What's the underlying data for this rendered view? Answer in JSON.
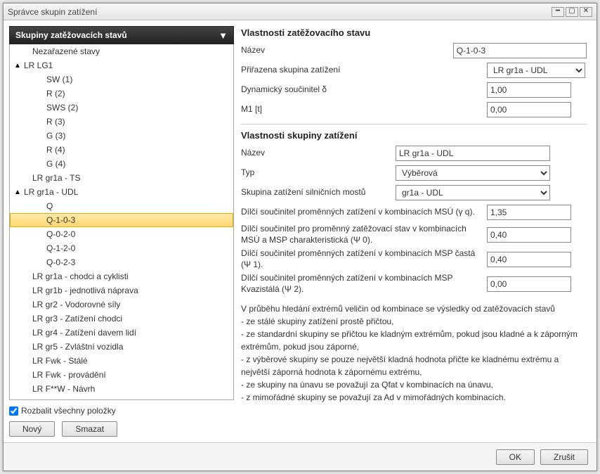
{
  "window": {
    "title": "Správce skupin zatížení"
  },
  "tree": {
    "header": "Skupiny zatěžovacích stavů",
    "items": [
      {
        "label": "Nezařazené stavy",
        "pad": "pad1",
        "arrow": ""
      },
      {
        "label": "LR LG1",
        "pad": "pad0",
        "arrow": "▲"
      },
      {
        "label": "SW (1)",
        "pad": "pad2",
        "arrow": ""
      },
      {
        "label": "R (2)",
        "pad": "pad2",
        "arrow": ""
      },
      {
        "label": "SWS (2)",
        "pad": "pad2",
        "arrow": ""
      },
      {
        "label": "R (3)",
        "pad": "pad2",
        "arrow": ""
      },
      {
        "label": "G (3)",
        "pad": "pad2",
        "arrow": ""
      },
      {
        "label": "R (4)",
        "pad": "pad2",
        "arrow": ""
      },
      {
        "label": "G (4)",
        "pad": "pad2",
        "arrow": ""
      },
      {
        "label": "LR gr1a - TS",
        "pad": "pad1",
        "arrow": ""
      },
      {
        "label": "LR gr1a - UDL",
        "pad": "pad0",
        "arrow": "▲"
      },
      {
        "label": "Q",
        "pad": "pad2",
        "arrow": ""
      },
      {
        "label": "Q-1-0-3",
        "pad": "pad2",
        "arrow": "",
        "sel": true
      },
      {
        "label": "Q-0-2-0",
        "pad": "pad2",
        "arrow": ""
      },
      {
        "label": "Q-1-2-0",
        "pad": "pad2",
        "arrow": ""
      },
      {
        "label": "Q-0-2-3",
        "pad": "pad2",
        "arrow": ""
      },
      {
        "label": "LR gr1a - chodci a cyklisti",
        "pad": "pad1",
        "arrow": ""
      },
      {
        "label": "LR gr1b - jednotlivá náprava",
        "pad": "pad1",
        "arrow": ""
      },
      {
        "label": "LR gr2 - Vodorovné síly",
        "pad": "pad1",
        "arrow": ""
      },
      {
        "label": "LR gr3 - Zatížení chodci",
        "pad": "pad1",
        "arrow": ""
      },
      {
        "label": "LR gr4 - Zatížení davem lidí",
        "pad": "pad1",
        "arrow": ""
      },
      {
        "label": "LR gr5 - Zvláštní vozidla",
        "pad": "pad1",
        "arrow": ""
      },
      {
        "label": "LR Fwk - Stálé",
        "pad": "pad1",
        "arrow": ""
      },
      {
        "label": "LR Fwk - provádění",
        "pad": "pad1",
        "arrow": ""
      },
      {
        "label": "LR F**W - Návrh",
        "pad": "pad1",
        "arrow": ""
      }
    ]
  },
  "expandAll": "Rozbalit všechny položky",
  "buttons": {
    "new": "Nový",
    "delete": "Smazat",
    "ok": "OK",
    "cancel": "Zrušit"
  },
  "lc": {
    "title": "Vlastnosti zatěžovacího stavu",
    "name_label": "Název",
    "name_value": "Q-1-0-3",
    "group_label": "Přiřazena skupina zatížení",
    "group_value": "LR gr1a - UDL",
    "dyn_label": "Dynamický součinitel δ",
    "dyn_value": "1,00",
    "m1_label": "M1 [t]",
    "m1_value": "0,00"
  },
  "grp": {
    "title": "Vlastnosti skupiny zatížení",
    "name_label": "Název",
    "name_value": "LR gr1a - UDL",
    "type_label": "Typ",
    "type_value": "Výběrová",
    "bridge_label": "Skupina zatížení silničních mostů",
    "bridge_value": "gr1a - UDL",
    "c1_label": "Dílčí součinitel proměnných zatížení v kombinacích MSÚ (γ q).",
    "c1_value": "1,35",
    "c2_label": "Dílčí součinitel pro proměnný zatěžovací stav v kombinacích MSÚ a MSP charakteristická (Ψ 0).",
    "c2_value": "0,40",
    "c3_label": "Dílčí součinitel proměnných zatížení v kombinacích MSP častá  (Ψ 1).",
    "c3_value": "0,40",
    "c4_label": "Dílčí součinitel proměnných zatížení v kombinacích MSP Kvazistálá  (Ψ 2).",
    "c4_value": "0,00"
  },
  "info": {
    "l0": "V průběhu hledání extrémů veličin od kombinace se výsledky od zatěžovacích stavů",
    "l1": "- ze stálé skupiny zatížení prostě přičtou,",
    "l2": "- ze standardní skupiny se přičtou ke kladným extrémům, pokud jsou kladné a k záporným extrémům, pokud jsou záporné,",
    "l3": "- z výběrové skupiny se pouze největší kladná hodnota přičte ke kladnému extrému a největší záporná hodnota k zápornému extrému,",
    "l4": "- ze skupiny na únavu se považují za Qfat v kombinacích na únavu,",
    "l5": "- z mimořádné skupiny se považují za Ad v mimořádných kombinacích."
  }
}
